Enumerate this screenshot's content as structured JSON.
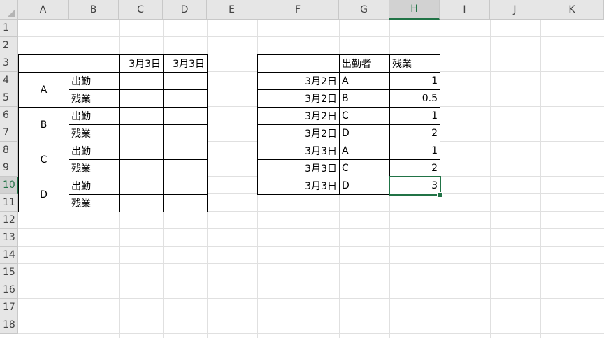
{
  "columns": [
    "A",
    "B",
    "C",
    "D",
    "E",
    "F",
    "G",
    "H",
    "I",
    "J",
    "K"
  ],
  "rows": [
    "1",
    "2",
    "3",
    "4",
    "5",
    "6",
    "7",
    "8",
    "9",
    "10",
    "11",
    "12",
    "13",
    "14",
    "15",
    "16",
    "17",
    "18"
  ],
  "selected": {
    "column": "H",
    "row": "10"
  },
  "left_table": {
    "header_dates": [
      "3月3日",
      "3月3日"
    ],
    "groups": [
      {
        "name": "A",
        "items": [
          "出勤",
          "残業"
        ]
      },
      {
        "name": "B",
        "items": [
          "出勤",
          "残業"
        ]
      },
      {
        "name": "C",
        "items": [
          "出勤",
          "残業"
        ]
      },
      {
        "name": "D",
        "items": [
          "出勤",
          "残業"
        ]
      }
    ]
  },
  "right_table": {
    "headers": {
      "f": "",
      "g": "出勤者",
      "h": "残業"
    },
    "rows": [
      {
        "date": "3月2日",
        "person": "A",
        "overtime": "1"
      },
      {
        "date": "3月2日",
        "person": "B",
        "overtime": "0.5"
      },
      {
        "date": "3月2日",
        "person": "C",
        "overtime": "1"
      },
      {
        "date": "3月2日",
        "person": "D",
        "overtime": "2"
      },
      {
        "date": "3月3日",
        "person": "A",
        "overtime": "1"
      },
      {
        "date": "3月3日",
        "person": "C",
        "overtime": "2"
      },
      {
        "date": "3月3日",
        "person": "D",
        "overtime": "3"
      }
    ]
  },
  "colors": {
    "accent": "#217346",
    "header_bg": "#e6e6e6",
    "gridline": "#e0e0e0"
  }
}
